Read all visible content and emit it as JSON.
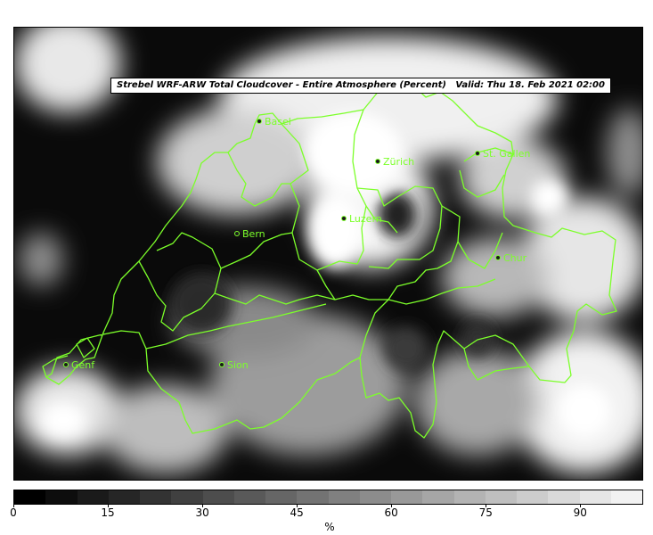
{
  "title": "Strebel WRF-ARW Total Cloudcover - Entire Atmosphere (Percent)   Valid: Thu 18. Feb 2021 02:00",
  "colors": {
    "border": "#7cff2a",
    "city_marker": "#1a1a1a",
    "label": "#7cff2a"
  },
  "cities": [
    {
      "name": "Basel"
    },
    {
      "name": "Zürich"
    },
    {
      "name": "St. Gallen"
    },
    {
      "name": "Luzern"
    },
    {
      "name": "Bern"
    },
    {
      "name": "Chur"
    },
    {
      "name": "Sion"
    },
    {
      "name": "Genf"
    }
  ],
  "colorbar": {
    "ticks": [
      "0",
      "15",
      "30",
      "45",
      "60",
      "75",
      "90"
    ],
    "unit": "%",
    "range": [
      0,
      100
    ],
    "levels": 20,
    "colors": [
      "#000000",
      "#0d0d0d",
      "#1a1a1a",
      "#262626",
      "#333333",
      "#404040",
      "#4d4d4d",
      "#595959",
      "#666666",
      "#737373",
      "#808080",
      "#8c8c8c",
      "#999999",
      "#a6a6a6",
      "#b3b3b3",
      "#bfbfbf",
      "#cccccc",
      "#d9d9d9",
      "#e6e6e6",
      "#f2f2f2"
    ]
  }
}
